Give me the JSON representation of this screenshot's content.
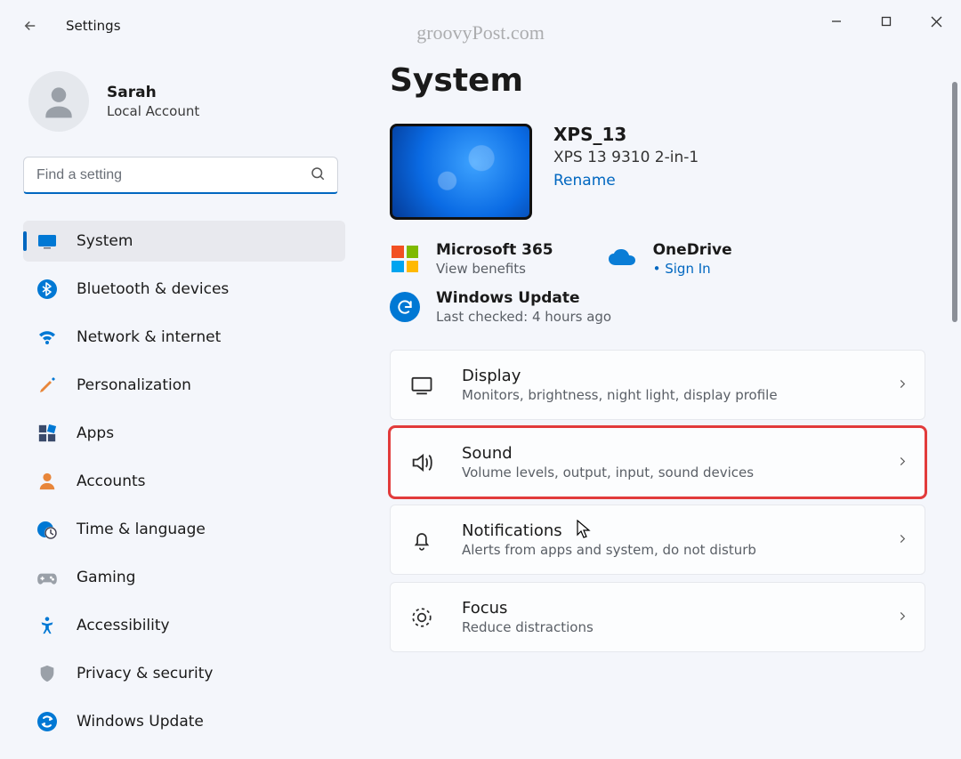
{
  "titlebar": {
    "label": "Settings"
  },
  "watermark": "groovyPost.com",
  "profile": {
    "name": "Sarah",
    "account_type": "Local Account"
  },
  "search": {
    "placeholder": "Find a setting"
  },
  "nav": [
    {
      "key": "system",
      "label": "System",
      "selected": true
    },
    {
      "key": "bluetooth",
      "label": "Bluetooth & devices"
    },
    {
      "key": "network",
      "label": "Network & internet"
    },
    {
      "key": "personalization",
      "label": "Personalization"
    },
    {
      "key": "apps",
      "label": "Apps"
    },
    {
      "key": "accounts",
      "label": "Accounts"
    },
    {
      "key": "time",
      "label": "Time & language"
    },
    {
      "key": "gaming",
      "label": "Gaming"
    },
    {
      "key": "accessibility",
      "label": "Accessibility"
    },
    {
      "key": "privacy",
      "label": "Privacy & security"
    },
    {
      "key": "update",
      "label": "Windows Update"
    }
  ],
  "main": {
    "title": "System",
    "device": {
      "name": "XPS_13",
      "model": "XPS 13 9310 2-in-1",
      "rename_label": "Rename"
    },
    "services": {
      "m365": {
        "title": "Microsoft 365",
        "subtitle": "View benefits"
      },
      "onedrive": {
        "title": "OneDrive",
        "subtitle": "Sign In"
      }
    },
    "update": {
      "title": "Windows Update",
      "subtitle": "Last checked: 4 hours ago"
    },
    "cards": [
      {
        "key": "display",
        "title": "Display",
        "subtitle": "Monitors, brightness, night light, display profile"
      },
      {
        "key": "sound",
        "title": "Sound",
        "subtitle": "Volume levels, output, input, sound devices",
        "highlight": true
      },
      {
        "key": "notifications",
        "title": "Notifications",
        "subtitle": "Alerts from apps and system, do not disturb"
      },
      {
        "key": "focus",
        "title": "Focus",
        "subtitle": "Reduce distractions"
      }
    ]
  }
}
